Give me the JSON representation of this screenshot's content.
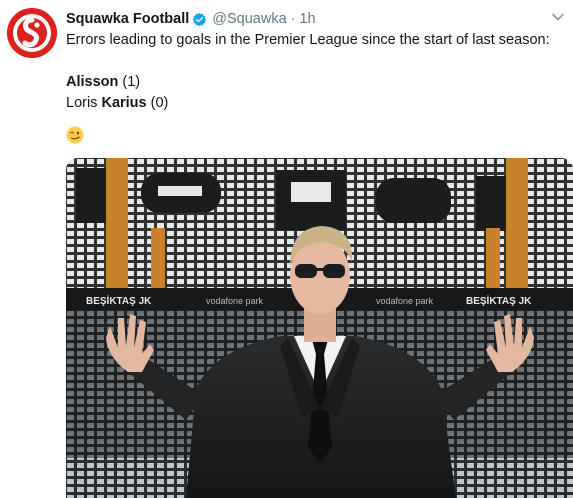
{
  "tweet": {
    "author_name": "Squawka Football",
    "author_handle": "@Squawka",
    "separator": "·",
    "timestamp": "1h",
    "intro": "Errors leading to goals in the Premier League since the start of last season:",
    "line1_name": "Alisson",
    "line1_count": " (1)",
    "line2_first": "Loris ",
    "line2_last": "Karius",
    "line2_count": " (0)",
    "emoji": "smirking-wink-emoji"
  },
  "media": {
    "banner_text_1": "BEŞİKTAŞ JK",
    "banner_text_2": "vodafone park"
  },
  "colors": {
    "brand_red": "#e0201d",
    "verified_blue": "#1da1f2",
    "secondary_text": "#657786"
  },
  "icons": {
    "avatar": "squawka-logo-icon",
    "verified": "verified-badge-icon",
    "menu": "chevron-down-icon"
  }
}
